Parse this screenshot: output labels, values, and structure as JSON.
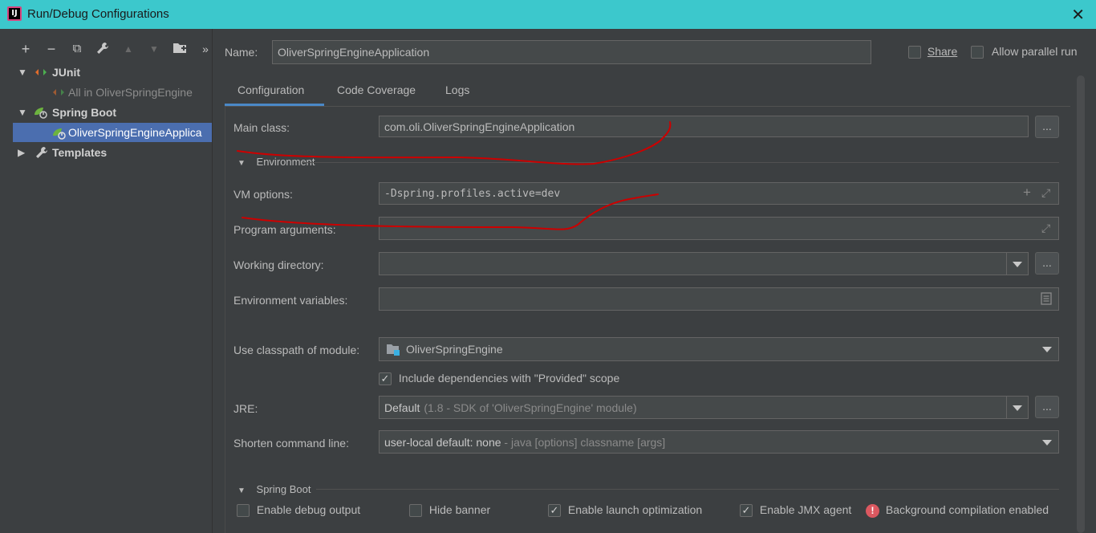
{
  "window": {
    "title": "Run/Debug Configurations",
    "close_icon": "close-icon"
  },
  "toolbar": {
    "icons": [
      "add-icon",
      "remove-icon",
      "copy-icon",
      "wrench-icon",
      "move-up-icon",
      "move-down-icon",
      "folder-icon",
      "more-icon"
    ],
    "glyphs": [
      "+",
      "−",
      "⧉",
      "🔧",
      "▲",
      "▼",
      "▣",
      "»"
    ]
  },
  "tree": {
    "junit": "JUnit",
    "junit_child": "All in OliverSpringEngine",
    "spring_boot": "Spring Boot",
    "spring_child": "OliverSpringEngineApplica",
    "templates": "Templates"
  },
  "config": {
    "name_label": "Name:",
    "name_value": "OliverSpringEngineApplication",
    "share_label": "Share",
    "parallel_label": "Allow parallel run"
  },
  "tabs": [
    "Configuration",
    "Code Coverage",
    "Logs"
  ],
  "form": {
    "main_class_label": "Main class:",
    "main_class_value": "com.oli.OliverSpringEngineApplication",
    "dots": "...",
    "environment_label": "Environment",
    "vm_options_label": "VM options:",
    "vm_options_value": "-Dspring.profiles.active=dev",
    "program_args_label": "Program arguments:",
    "working_dir_label": "Working directory:",
    "env_vars_label": "Environment variables:",
    "classpath_label": "Use classpath of module:",
    "classpath_value": "OliverSpringEngine",
    "include_deps_label": "Include dependencies with \"Provided\" scope",
    "include_deps_checked": true,
    "jre_label": "JRE:",
    "jre_value": "Default",
    "jre_detail": "(1.8 - SDK of 'OliverSpringEngine' module)",
    "shorten_label": "Shorten command line:",
    "shorten_value": "user-local default: none",
    "shorten_detail": " - java [options] classname [args]"
  },
  "spring_boot_section": {
    "label": "Spring Boot",
    "debug_output": "Enable debug output",
    "hide_banner": "Hide banner",
    "launch_opt": "Enable launch optimization",
    "jmx_agent": "Enable JMX agent",
    "bg_compilation": "Background compilation enabled",
    "debug_checked": false,
    "banner_checked": false,
    "launch_checked": true,
    "jmx_checked": true
  },
  "colors": {
    "titlebar": "#3cc8cc",
    "selection": "#4b6eaf",
    "annotation": "#cc0000",
    "tab_underline": "#4a88c7"
  }
}
